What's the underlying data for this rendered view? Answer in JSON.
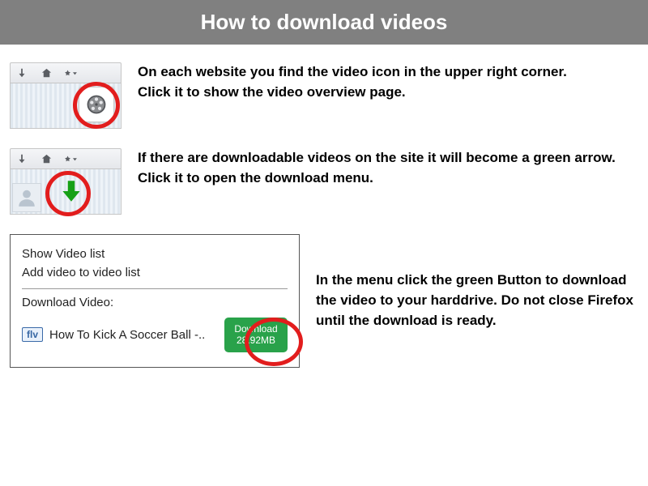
{
  "title": "How to download videos",
  "step1": {
    "text": "On each website you find the video icon in the upper right corner.\nClick it to show the video overview page."
  },
  "step2": {
    "text": "If there are downloadable videos on the site it will become a green arrow.\nClick it to open the download menu."
  },
  "step3": {
    "menu": {
      "show_list": "Show Video list",
      "add_video": "Add video to video list",
      "download_heading": "Download Video:",
      "flv_badge": "flv",
      "video_title": "How To Kick A Soccer Ball -..",
      "download_label": "Download",
      "download_size": "28.92MB"
    },
    "text": "In the menu click the green Button to download the video to your harddrive. Do not close Firefox until the download is ready."
  }
}
